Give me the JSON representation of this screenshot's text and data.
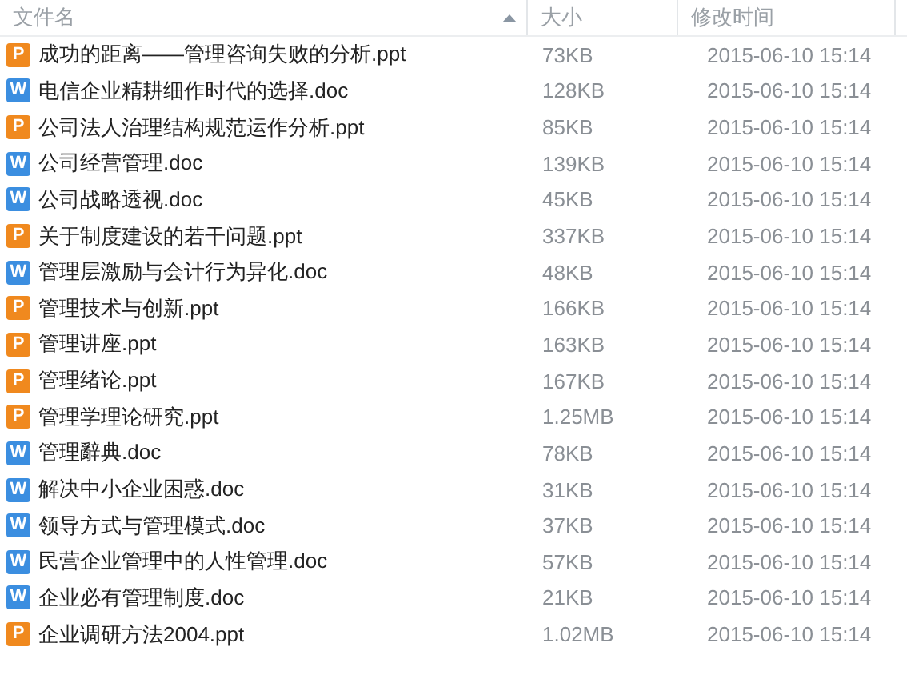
{
  "columns": [
    {
      "label": "文件名",
      "sorted": true
    },
    {
      "label": "大小",
      "sorted": false
    },
    {
      "label": "修改时间",
      "sorted": false
    }
  ],
  "rows": [
    {
      "kind": "ppt",
      "badge": "P",
      "name": "成功的距离——管理咨询失败的分析.ppt",
      "size": "73KB",
      "modified": "2015-06-10 15:14"
    },
    {
      "kind": "doc",
      "badge": "W",
      "name": "电信企业精耕细作时代的选择.doc",
      "size": "128KB",
      "modified": "2015-06-10 15:14"
    },
    {
      "kind": "ppt",
      "badge": "P",
      "name": "公司法人治理结构规范运作分析.ppt",
      "size": "85KB",
      "modified": "2015-06-10 15:14"
    },
    {
      "kind": "doc",
      "badge": "W",
      "name": "公司经营管理.doc",
      "size": "139KB",
      "modified": "2015-06-10 15:14"
    },
    {
      "kind": "doc",
      "badge": "W",
      "name": "公司战略透视.doc",
      "size": "45KB",
      "modified": "2015-06-10 15:14"
    },
    {
      "kind": "ppt",
      "badge": "P",
      "name": "关于制度建设的若干问题.ppt",
      "size": "337KB",
      "modified": "2015-06-10 15:14"
    },
    {
      "kind": "doc",
      "badge": "W",
      "name": "管理层激励与会计行为异化.doc",
      "size": "48KB",
      "modified": "2015-06-10 15:14"
    },
    {
      "kind": "ppt",
      "badge": "P",
      "name": "管理技术与创新.ppt",
      "size": "166KB",
      "modified": "2015-06-10 15:14"
    },
    {
      "kind": "ppt",
      "badge": "P",
      "name": "管理讲座.ppt",
      "size": "163KB",
      "modified": "2015-06-10 15:14"
    },
    {
      "kind": "ppt",
      "badge": "P",
      "name": "管理绪论.ppt",
      "size": "167KB",
      "modified": "2015-06-10 15:14"
    },
    {
      "kind": "ppt",
      "badge": "P",
      "name": "管理学理论研究.ppt",
      "size": "1.25MB",
      "modified": "2015-06-10 15:14"
    },
    {
      "kind": "doc",
      "badge": "W",
      "name": "管理辭典.doc",
      "size": "78KB",
      "modified": "2015-06-10 15:14"
    },
    {
      "kind": "doc",
      "badge": "W",
      "name": "解决中小企业困惑.doc",
      "size": "31KB",
      "modified": "2015-06-10 15:14"
    },
    {
      "kind": "doc",
      "badge": "W",
      "name": "领导方式与管理模式.doc",
      "size": "37KB",
      "modified": "2015-06-10 15:14"
    },
    {
      "kind": "doc",
      "badge": "W",
      "name": "民营企业管理中的人性管理.doc",
      "size": "57KB",
      "modified": "2015-06-10 15:14"
    },
    {
      "kind": "doc",
      "badge": "W",
      "name": "企业必有管理制度.doc",
      "size": "21KB",
      "modified": "2015-06-10 15:14"
    },
    {
      "kind": "ppt",
      "badge": "P",
      "name": "企业调研方法2004.ppt",
      "size": "1.02MB",
      "modified": "2015-06-10 15:14"
    }
  ]
}
